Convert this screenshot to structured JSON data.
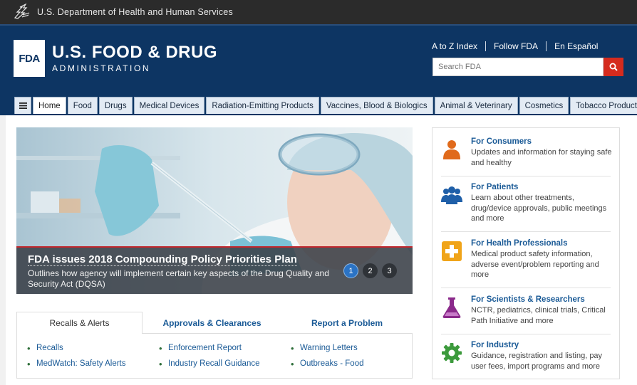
{
  "hhs_bar": {
    "text": "U.S. Department of Health and Human Services",
    "icon": "hhs-eagle-icon"
  },
  "header": {
    "logo_mark": "FDA",
    "title": "U.S. FOOD & DRUG",
    "subtitle": "ADMINISTRATION",
    "links": [
      "A to Z Index",
      "Follow FDA",
      "En Español"
    ],
    "search_placeholder": "Search FDA",
    "search_icon": "search-icon"
  },
  "nav": {
    "menu_icon": "hamburger-menu-icon",
    "tabs": [
      "Home",
      "Food",
      "Drugs",
      "Medical Devices",
      "Radiation-Emitting Products",
      "Vaccines, Blood & Biologics",
      "Animal & Veterinary",
      "Cosmetics",
      "Tobacco Products"
    ],
    "active": "Home"
  },
  "hero": {
    "title": "FDA issues 2018 Compounding Policy Priorities Plan",
    "subtitle": "Outlines how agency will implement certain key aspects of the Drug Quality and Security Act (DQSA)",
    "slides": [
      "1",
      "2",
      "3"
    ],
    "active_slide": "1"
  },
  "panel": {
    "tabs": [
      "Recalls & Alerts",
      "Approvals & Clearances",
      "Report a Problem"
    ],
    "active": "Recalls & Alerts",
    "links": [
      "Recalls",
      "Enforcement Report",
      "Warning Letters",
      "MedWatch: Safety Alerts",
      "Industry Recall Guidance",
      "Outbreaks - Food"
    ]
  },
  "sidebar": {
    "items": [
      {
        "title": "For Consumers",
        "desc": "Updates and information for staying safe and healthy",
        "icon": "person-icon"
      },
      {
        "title": "For Patients",
        "desc": "Learn about other treatments, drug/device approvals, public meetings and more",
        "icon": "people-group-icon"
      },
      {
        "title": "For Health Professionals",
        "desc": "Medical product safety information, adverse event/problem reporting and more",
        "icon": "medical-cross-icon"
      },
      {
        "title": "For Scientists & Researchers",
        "desc": "NCTR, pediatrics, clinical trials, Critical Path Initiative and more",
        "icon": "flask-icon"
      },
      {
        "title": "For Industry",
        "desc": "Guidance, registration and listing, pay user fees, import programs and more",
        "icon": "gear-icon"
      }
    ]
  },
  "colors": {
    "header_bg": "#0d3563",
    "hhs_bar_bg": "#2b2b2b",
    "search_button": "#d52b1e",
    "link": "#1a5a96",
    "consumers_icon": "#e06a1b",
    "patients_icon": "#1f5fa8",
    "health_pros_icon": "#f0a419",
    "scientists_icon": "#8b2a8b",
    "industry_icon": "#3c9a3c"
  }
}
